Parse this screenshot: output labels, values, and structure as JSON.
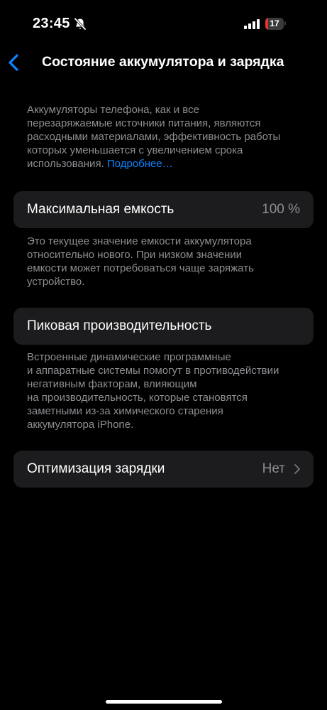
{
  "status_bar": {
    "time": "23:45",
    "battery_level": "17",
    "battery_fraction": 0.17,
    "battery_color": "#e5342f",
    "silent_icon": "bell-slash-icon",
    "signal_icon": "cellular-signal-icon"
  },
  "nav": {
    "back_icon": "chevron-left-icon",
    "title": "Состояние аккумулятора и зарядка"
  },
  "intro": {
    "lines": [
      "Аккумуляторы телефона, как и все",
      "перезаряжаемые источники питания, являются",
      "расходными материалами, эффективность работы",
      "которых уменьшается с увеличением срока"
    ],
    "last_line_prefix": "использования. ",
    "link": "Подробнее…"
  },
  "max_capacity": {
    "label": "Максимальная емкость",
    "value": "100 %",
    "description_lines": [
      "Это текущее значение емкости аккумулятора",
      "относительно нового. При низком значении",
      "емкости может потребоваться чаще заряжать",
      "устройство."
    ]
  },
  "peak_performance": {
    "label": "Пиковая производительность",
    "description_lines": [
      "Встроенные динамические программные",
      "и аппаратные системы помогут в противодействии",
      "негативным факторам, влияющим",
      "на производительность, которые становятся",
      "заметными из-за химического старения",
      "аккумулятора iPhone."
    ]
  },
  "charging_optimization": {
    "label": "Оптимизация зарядки",
    "value": "Нет",
    "chevron_icon": "chevron-right-icon"
  },
  "colors": {
    "accent": "#0a84ff",
    "background": "#000000",
    "cell_background": "#1c1c1e",
    "secondary_text": "#8e8e93"
  }
}
